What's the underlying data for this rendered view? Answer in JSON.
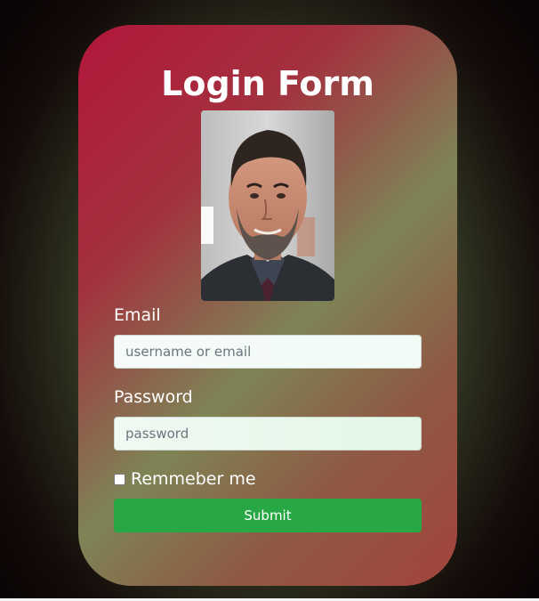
{
  "form": {
    "title": "Login Form",
    "avatar_icon": "user-photo",
    "email": {
      "label": "Email",
      "value": "",
      "placeholder": "username or email"
    },
    "password": {
      "label": "Password",
      "value": "",
      "placeholder": "password"
    },
    "remember": {
      "label": "Remmeber me",
      "checked": false
    },
    "submit_label": "Submit"
  },
  "colors": {
    "card_start": "#b2173a",
    "card_mid": "#7e8456",
    "submit_bg": "#28a745",
    "text": "#ffffff"
  }
}
